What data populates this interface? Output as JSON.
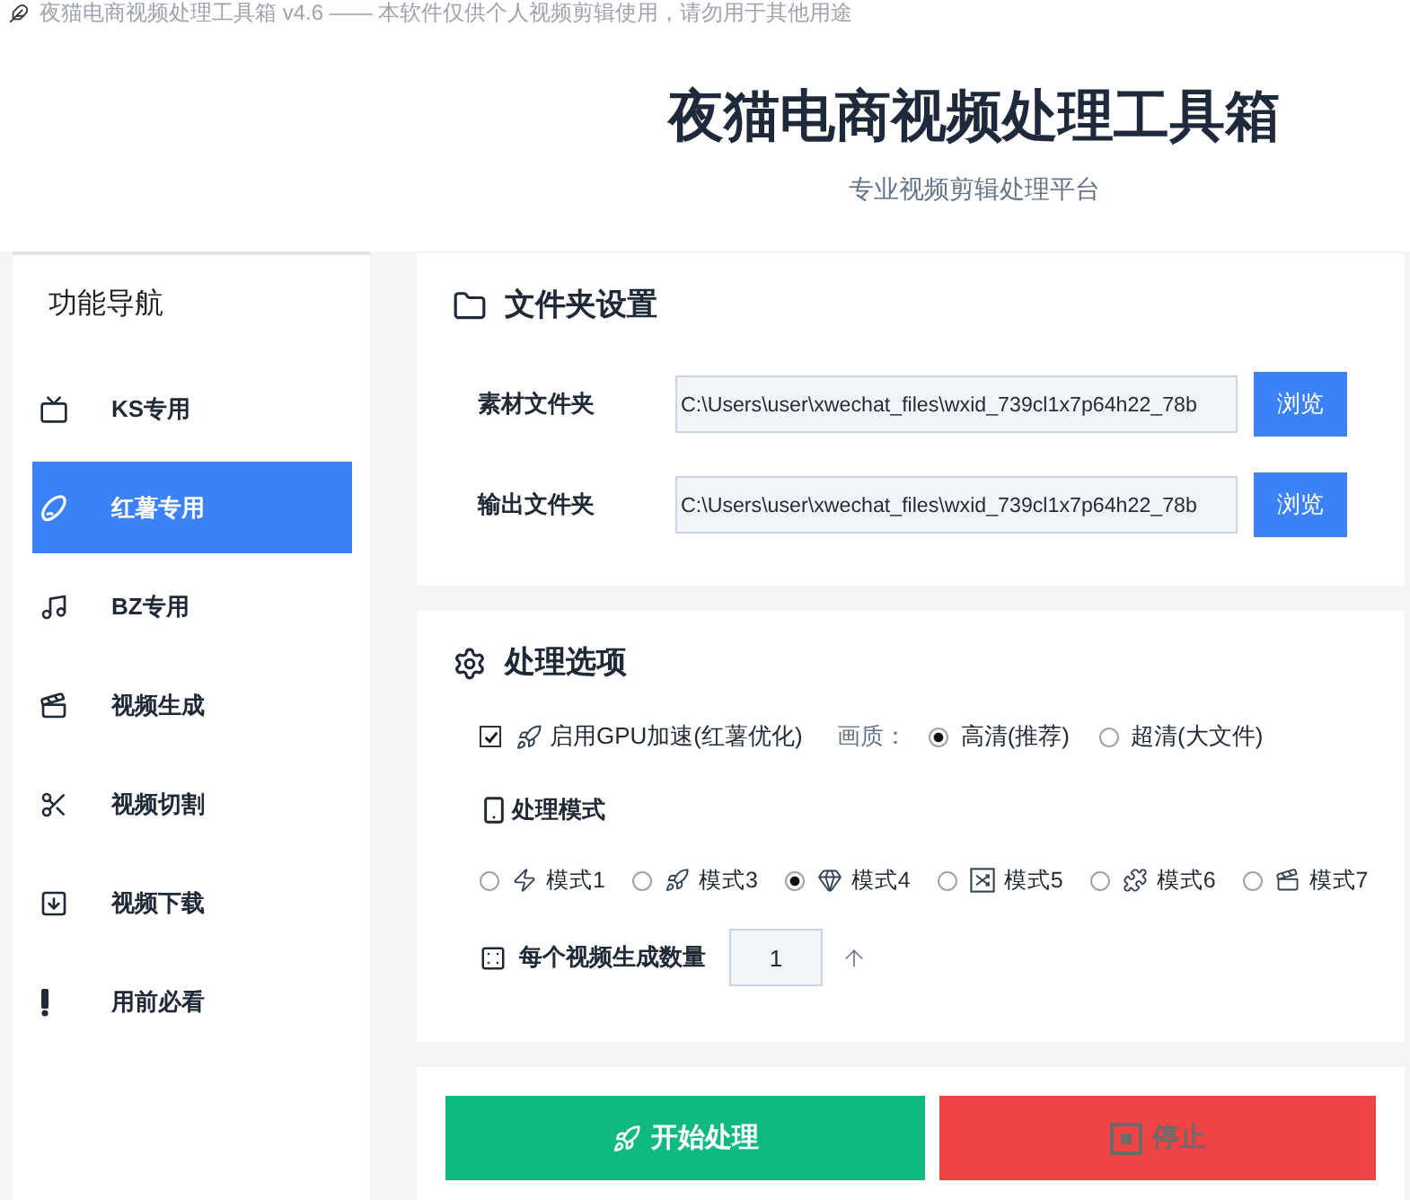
{
  "window": {
    "title": "夜猫电商视频处理工具箱 v4.6 —— 本软件仅供个人视频剪辑使用，请勿用于其他用途"
  },
  "header": {
    "title": "夜猫电商视频处理工具箱",
    "subtitle": "专业视频剪辑处理平台"
  },
  "sidebar": {
    "title": "功能导航",
    "items": [
      {
        "label": "KS专用",
        "selected": false
      },
      {
        "label": "红薯专用",
        "selected": true
      },
      {
        "label": "BZ专用",
        "selected": false
      },
      {
        "label": "视频生成",
        "selected": false
      },
      {
        "label": "视频切割",
        "selected": false
      },
      {
        "label": "视频下载",
        "selected": false
      },
      {
        "label": "用前必看",
        "selected": false
      }
    ]
  },
  "folders": {
    "title": "文件夹设置",
    "rows": [
      {
        "label": "素材文件夹",
        "value": "C:\\Users\\user\\xwechat_files\\wxid_739cl1x7p64h22_78b",
        "button": "浏览"
      },
      {
        "label": "输出文件夹",
        "value": "C:\\Users\\user\\xwechat_files\\wxid_739cl1x7p64h22_78b",
        "button": "浏览"
      }
    ]
  },
  "options": {
    "title": "处理选项",
    "gpu": {
      "label": "启用GPU加速(红薯优化)",
      "checked": true
    },
    "quality": {
      "label": "画质：",
      "options": [
        {
          "label": "高清(推荐)",
          "selected": true
        },
        {
          "label": "超清(大文件)",
          "selected": false
        }
      ]
    },
    "mode": {
      "title": "处理模式",
      "options": [
        {
          "label": "模式1",
          "selected": false
        },
        {
          "label": "模式3",
          "selected": false
        },
        {
          "label": "模式4",
          "selected": true
        },
        {
          "label": "模式5",
          "selected": false
        },
        {
          "label": "模式6",
          "selected": false
        },
        {
          "label": "模式7",
          "selected": false
        }
      ]
    },
    "count": {
      "label": "每个视频生成数量",
      "value": "1"
    }
  },
  "actions": [
    {
      "kind": "start",
      "label": "开始处理",
      "disabled": false
    },
    {
      "kind": "stop",
      "label": "停止",
      "disabled": true
    }
  ]
}
